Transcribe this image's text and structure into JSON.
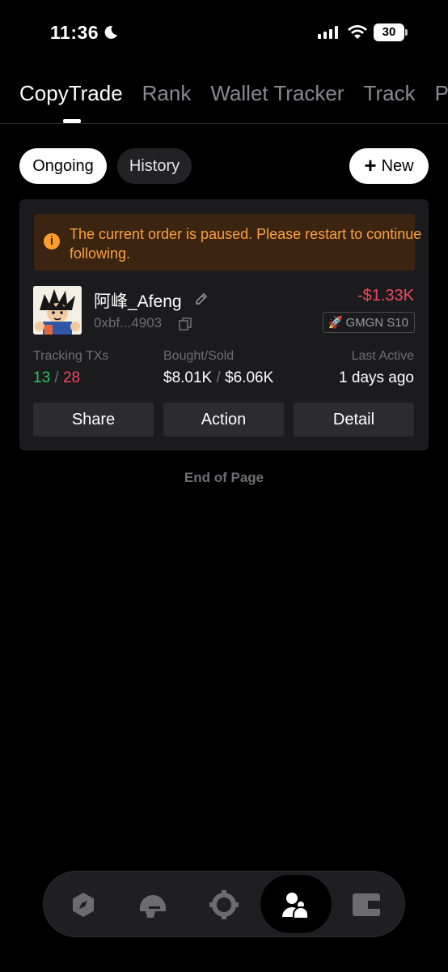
{
  "status_bar": {
    "time": "11:36",
    "battery": "30"
  },
  "top_tabs": [
    {
      "label": "CopyTrade",
      "active": true
    },
    {
      "label": "Rank",
      "active": false
    },
    {
      "label": "Wallet Tracker",
      "active": false
    },
    {
      "label": "Track",
      "active": false
    },
    {
      "label": "P",
      "active": false
    }
  ],
  "filters": {
    "ongoing": "Ongoing",
    "history": "History",
    "new_label": "New"
  },
  "card": {
    "notice": "The current order is paused. Please restart to continue following.",
    "name": "阿峰_Afeng",
    "address": "0xbf...4903",
    "pnl": "-$1.33K",
    "badge_icon": "🚀",
    "badge": "GMGN S10",
    "stats": {
      "tracking_label": "Tracking TXs",
      "tracking_success": "13",
      "tracking_sep": "/",
      "tracking_total": "28",
      "bought_label": "Bought/Sold",
      "bought": "$8.01K",
      "bought_sep": "/",
      "sold": "$6.06K",
      "last_active_label": "Last Active",
      "last_active": "1 days ago"
    },
    "buttons": {
      "share": "Share",
      "action": "Action",
      "detail": "Detail"
    }
  },
  "end_of_page": "End of Page",
  "bottom_nav": [
    {
      "icon": "explore-hexagon-icon",
      "active": false
    },
    {
      "icon": "helmet-icon",
      "active": false
    },
    {
      "icon": "target-gear-icon",
      "active": false
    },
    {
      "icon": "copytrade-users-icon",
      "active": true
    },
    {
      "icon": "wallet-icon",
      "active": false
    }
  ],
  "colors": {
    "background": "#000000",
    "card": "#1b1b1d",
    "notice_bg": "#3b2511",
    "notice_text": "#ff9f3a",
    "positive": "#22c55e",
    "negative": "#f0475c"
  }
}
